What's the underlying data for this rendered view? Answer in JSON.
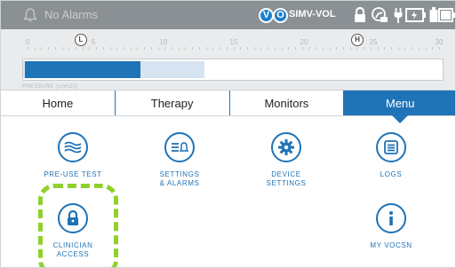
{
  "status": {
    "alarm_text": "No Alarms",
    "badges": [
      "V",
      "O"
    ],
    "mode": "SIMV-VOL",
    "icons": [
      "bell-icon",
      "lock-icon",
      "touch-lock-icon",
      "plug-icon",
      "battery-charging-icon",
      "battery-small-icon",
      "battery-icon"
    ]
  },
  "scale": {
    "ticks": [
      "0",
      "5",
      "10",
      "15",
      "20",
      "25",
      "30"
    ],
    "low_marker": "L",
    "high_marker": "H",
    "low_value": 3.7,
    "high_value": 22.5,
    "pressure_value": 8.3,
    "peak_value": 13.0,
    "max": 30,
    "label": "PRESSURE (cmH20)"
  },
  "tabs": [
    {
      "label": "Home"
    },
    {
      "label": "Therapy"
    },
    {
      "label": "Monitors"
    },
    {
      "label": "Menu"
    }
  ],
  "menu": {
    "pre_use_test": "PRE-USE TEST",
    "settings_alarms": "SETTINGS\n& ALARMS",
    "device_settings": "DEVICE\nSETTINGS",
    "logs": "LOGS",
    "clinician_access": "CLINICIAN\nACCESS",
    "my_vocsn": "MY VOCSN"
  },
  "colors": {
    "accent": "#1f73b7",
    "statusbar": "#8a9094",
    "highlight": "#8fd12c"
  }
}
